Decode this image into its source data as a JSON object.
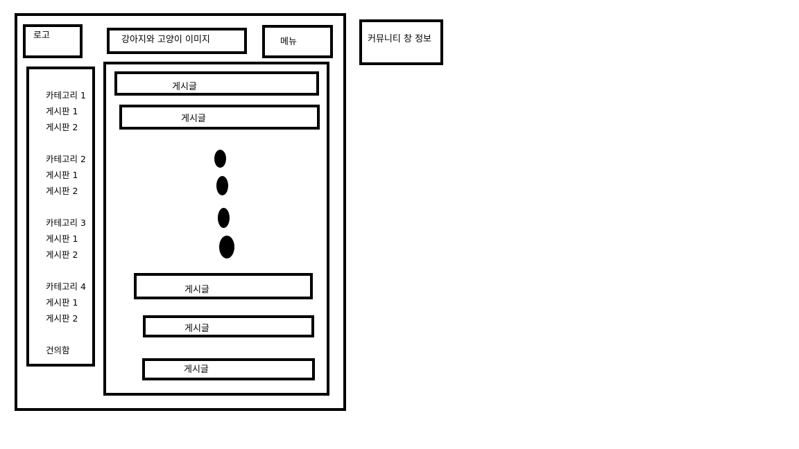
{
  "header": {
    "logo": "로고",
    "banner": "강아지와 고양이 이미지",
    "menu": "메뉴"
  },
  "sidebar": {
    "categories": [
      {
        "title": "카테고리 1",
        "boards": [
          "게시판 1",
          "게시판 2"
        ]
      },
      {
        "title": "카테고리 2",
        "boards": [
          "게시판 1",
          "게시판 2"
        ]
      },
      {
        "title": "카테고리 3",
        "boards": [
          "게시판 1",
          "게시판 2"
        ]
      },
      {
        "title": "카테고리 4",
        "boards": [
          "게시판 1",
          "게시판 2"
        ]
      }
    ],
    "suggestion": "건의함"
  },
  "posts": {
    "items": [
      "게시글",
      "게시글",
      "게시글",
      "게시글",
      "게시글"
    ]
  },
  "community_info": "커뮤니티 창 정보"
}
